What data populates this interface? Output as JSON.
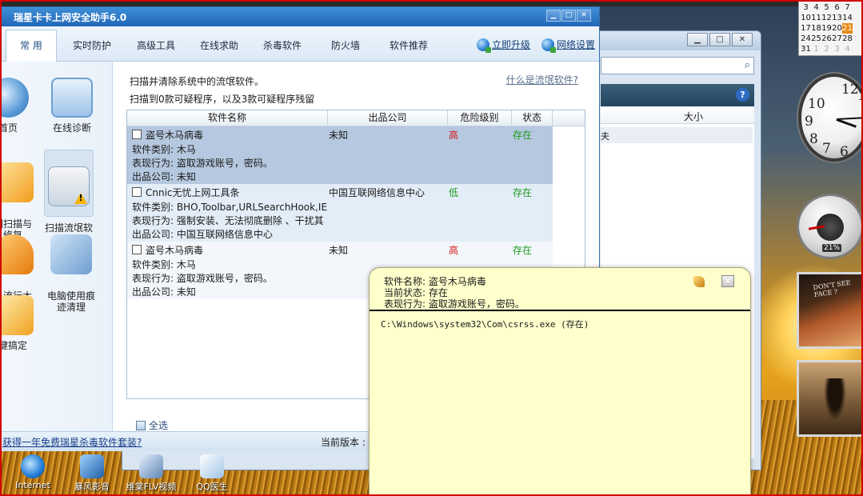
{
  "app": {
    "title": "瑞星卡卡上网安全助手6.0",
    "window_controls": [
      "minimize",
      "maximize",
      "close"
    ]
  },
  "menu": {
    "tabs": [
      "常 用",
      "实时防护",
      "高级工具",
      "在线求助",
      "杀毒软件",
      "防火墙",
      "软件推荐"
    ],
    "upgrade": "立即升级",
    "network": "网络设置"
  },
  "sidebar": {
    "items": [
      {
        "label": "首页",
        "icon": "home-icon"
      },
      {
        "label": "在线诊断",
        "icon": "diagnose-icon"
      },
      {
        "label": "洞扫描与\n修复",
        "icon": "repair-icon"
      },
      {
        "label": "扫描流氓软\n件",
        "icon": "scan-rogue-icon"
      },
      {
        "label": "杀流行木\n马",
        "icon": "kill-trojan-icon"
      },
      {
        "label": "电脑使用痕\n迹清理",
        "icon": "clean-trace-icon"
      },
      {
        "label": "键搞定",
        "icon": "one-click-icon"
      }
    ]
  },
  "main": {
    "desc1": "扫描并清除系统中的流氓软件。",
    "desc2": "扫描到0款可疑程序，以及3款可疑程序残留",
    "what_link": "什么是流氓软件?",
    "columns": [
      "软件名称",
      "出品公司",
      "危险级别",
      "状态"
    ],
    "rows": [
      {
        "name": "盗号木马病毒",
        "company": "未知",
        "level": "高",
        "status": "存在",
        "details": [
          "软件类别: 木马",
          "表现行为: 盗取游戏账号，密码。",
          "出品公司: 未知"
        ]
      },
      {
        "name": "Cnnic无忧上网工具条",
        "company": "中国互联网络信息中心",
        "level": "低",
        "status": "存在",
        "details": [
          "软件类别: BHO,Toolbar,URLSearchHook,IE右键",
          "表现行为: 强制安装、无法彻底删除 、干扰其",
          "出品公司: 中国互联网络信息中心"
        ]
      },
      {
        "name": "盗号木马病毒",
        "company": "未知",
        "level": "高",
        "status": "存在",
        "details": [
          "软件类别: 木马",
          "表现行为: 盗取游戏账号，密码。",
          "出品公司: 未知"
        ]
      }
    ],
    "select_all": "全选"
  },
  "statusbar": {
    "promo": "获得一年免费瑞星杀毒软件套装?",
    "version": "当前版本 :"
  },
  "tooltip": {
    "name_line": "软件名称: 盗号木马病毒",
    "state_line": "当前状态: 存在",
    "behavior_line": "表现行为: 盗取游戏账号，密码。",
    "path": "C:\\Windows\\system32\\Com\\csrss.exe  (存在)"
  },
  "background_window": {
    "column": "大小",
    "row_text": "夫"
  },
  "calendar": {
    "rows": [
      [
        "3",
        "4",
        "5",
        "6",
        "7"
      ],
      [
        "10",
        "11",
        "12",
        "13",
        "14"
      ],
      [
        "17",
        "18",
        "19",
        "20",
        "21"
      ],
      [
        "24",
        "25",
        "26",
        "27",
        "28"
      ],
      [
        "31",
        "1",
        "2",
        "3",
        "4"
      ]
    ]
  },
  "clock": {
    "numbers": [
      "12",
      "1",
      "10",
      "9",
      "8",
      "7",
      "6"
    ]
  },
  "cpu_meter": {
    "percent": "21%"
  },
  "photo": {
    "text": "DON'T SEE\nFACE ?"
  },
  "desktop_icons": [
    {
      "label": "Internet",
      "icon": "ie-icon"
    },
    {
      "label": "暴风影音",
      "icon": "storm-player-icon"
    },
    {
      "label": "维棠FLV视频",
      "icon": "flv-icon"
    },
    {
      "label": "QQ医生",
      "icon": "qq-doctor-icon"
    }
  ],
  "colors": {
    "title_blue": "#2067b8",
    "danger_high": "#d51616",
    "danger_low": "#1d9a1d",
    "status_exists": "#1d9a1d",
    "tooltip_bg": "#ffffcc"
  }
}
